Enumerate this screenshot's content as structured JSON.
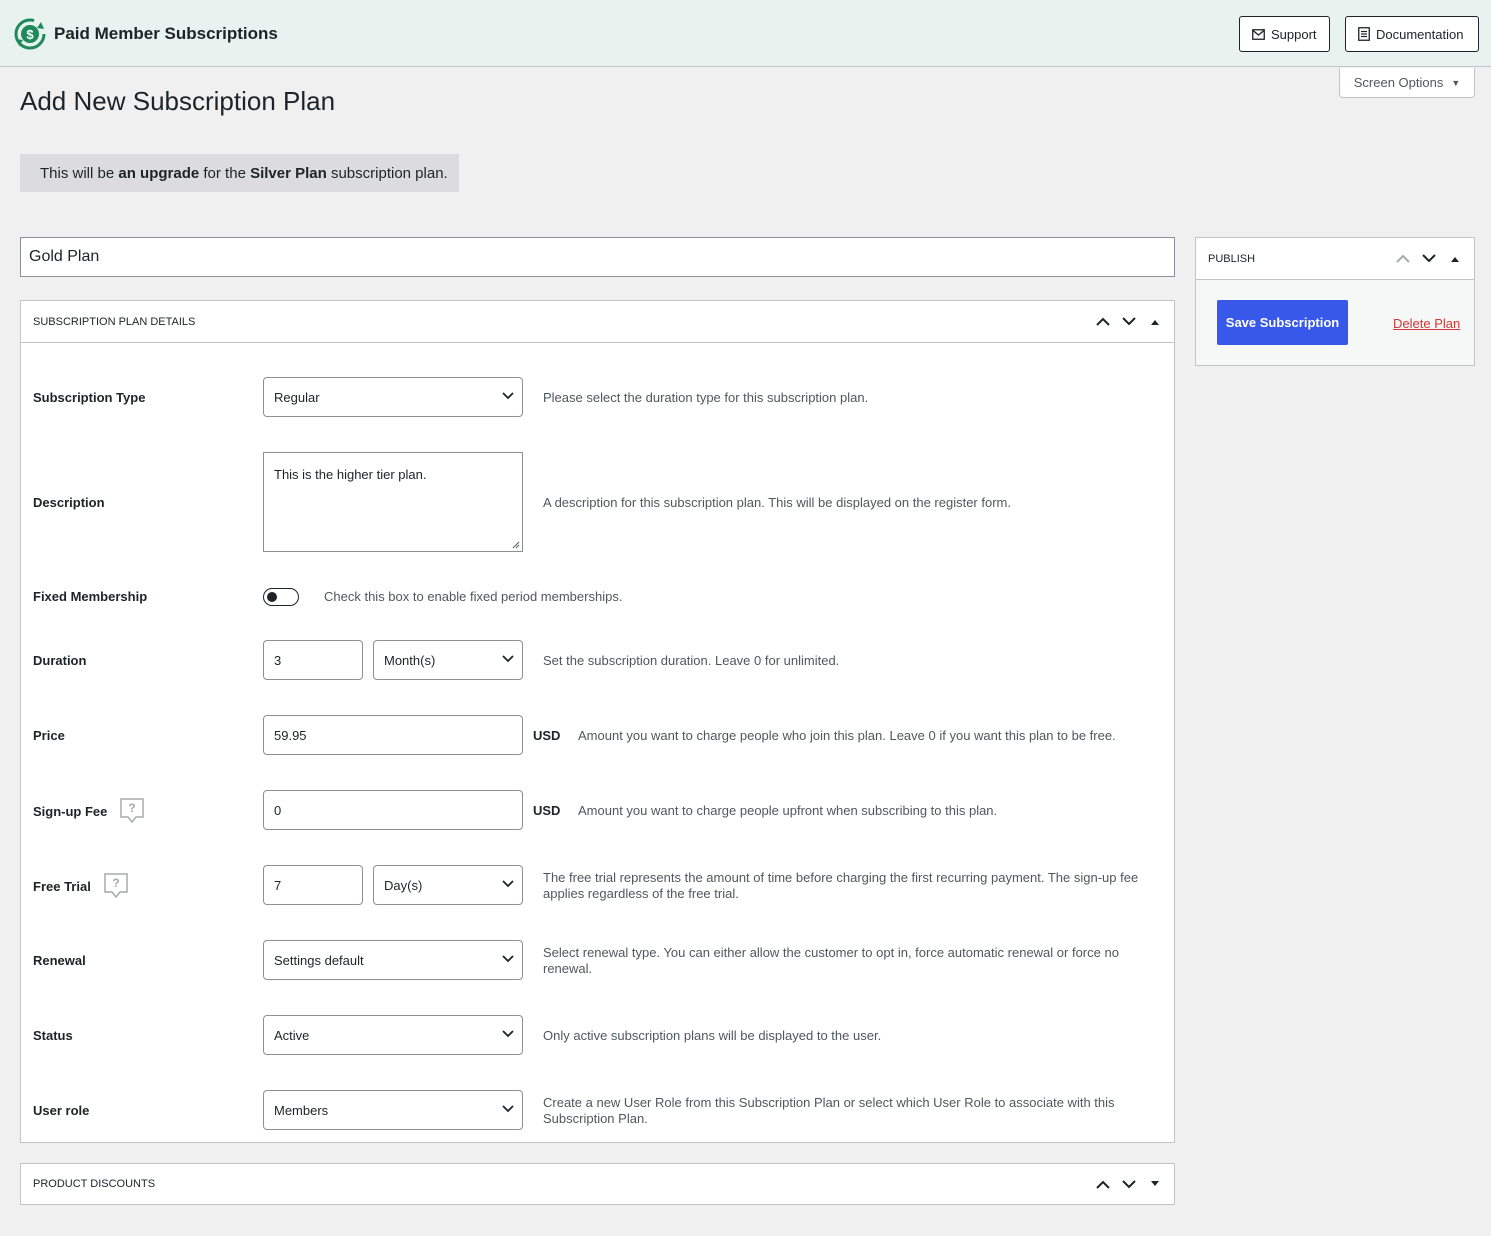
{
  "header": {
    "brand_name": "Paid Member Subscriptions",
    "support_label": "Support",
    "documentation_label": "Documentation"
  },
  "screen_options": {
    "label": "Screen Options"
  },
  "page_title": "Add New Subscription Plan",
  "notice": {
    "prefix": "This will be ",
    "upgrade_text": "an upgrade",
    "middle": " for the ",
    "plan_name": "Silver Plan",
    "suffix": " subscription plan."
  },
  "plan_title": {
    "value": "Gold Plan"
  },
  "details": {
    "heading": "Subscription Plan Details",
    "subscription_type": {
      "label": "Subscription Type",
      "value": "Regular",
      "description": "Please select the duration type for this subscription plan."
    },
    "description": {
      "label": "Description",
      "value": "This is the higher tier plan.",
      "description": "A description for this subscription plan. This will be displayed on the register form."
    },
    "fixed_membership": {
      "label": "Fixed Membership",
      "checked": false,
      "description": "Check this box to enable fixed period memberships."
    },
    "duration": {
      "label": "Duration",
      "value": "3",
      "unit": "Month(s)",
      "description": "Set the subscription duration. Leave 0 for unlimited."
    },
    "price": {
      "label": "Price",
      "value": "59.95",
      "currency": "USD",
      "description": "Amount you want to charge people who join this plan. Leave 0 if you want this plan to be free."
    },
    "signup_fee": {
      "label": "Sign-up Fee",
      "value": "0",
      "currency": "USD",
      "description": "Amount you want to charge people upfront when subscribing to this plan."
    },
    "free_trial": {
      "label": "Free Trial",
      "value": "7",
      "unit": "Day(s)",
      "description": "The free trial represents the amount of time before charging the first recurring payment. The sign-up fee applies regardless of the free trial."
    },
    "renewal": {
      "label": "Renewal",
      "value": "Settings default",
      "description": "Select renewal type. You can either allow the customer to opt in, force automatic renewal or force no renewal."
    },
    "status": {
      "label": "Status",
      "value": "Active",
      "description": "Only active subscription plans will be displayed to the user."
    },
    "user_role": {
      "label": "User role",
      "value": "Members",
      "description": "Create a new User Role from this Subscription Plan or select which User Role to associate with this Subscription Plan."
    }
  },
  "product_discounts": {
    "heading": "Product Discounts"
  },
  "publish": {
    "heading": "Publish",
    "save_label": "Save Subscription",
    "delete_label": "Delete Plan"
  },
  "colors": {
    "header_bg": "#e8f3ef",
    "brand_green": "#1e8a5a",
    "primary_button": "#3858e9",
    "delete_link": "#d63638"
  },
  "icons": [
    "pms-logo-icon",
    "mail-icon",
    "document-icon",
    "chevron-down-icon",
    "chevron-up-icon",
    "triangle-up-icon",
    "triangle-down-icon",
    "help-bubble-icon"
  ]
}
